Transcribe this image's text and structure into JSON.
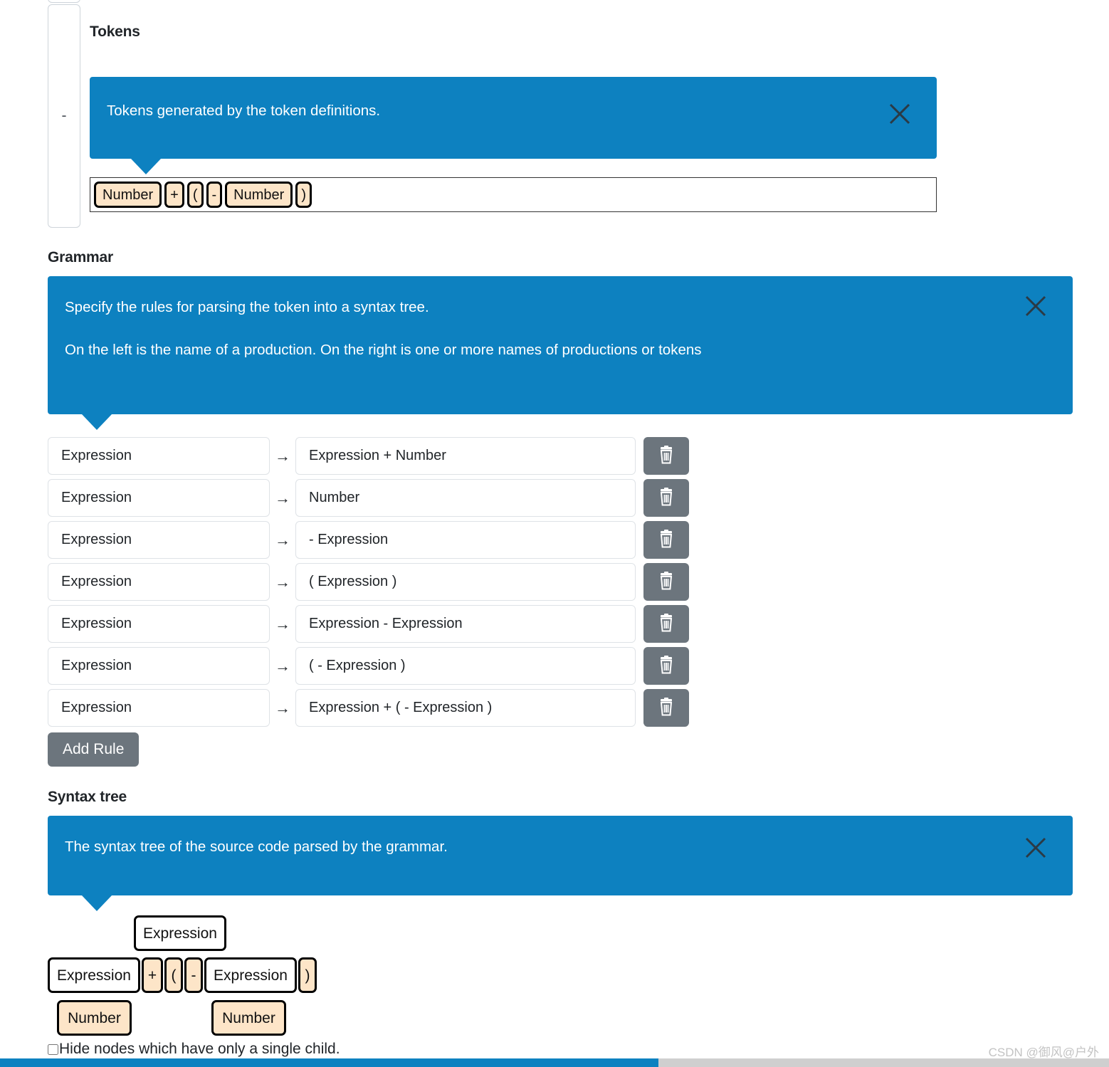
{
  "sections": {
    "tokens": {
      "heading": "Tokens",
      "tooltip": "Tokens generated by the token definitions.",
      "chips": [
        "Number",
        "+",
        "(",
        "-",
        "Number",
        ")"
      ]
    },
    "grammar": {
      "heading": "Grammar",
      "tooltip_line1": "Specify the rules for parsing the token into a syntax tree.",
      "tooltip_line2": "On the left is the name of a production. On the right is one or more names of productions or tokens",
      "arrow_glyph": "→",
      "rules": [
        {
          "lhs": "Expression",
          "rhs": "Expression + Number"
        },
        {
          "lhs": "Expression",
          "rhs": "Number"
        },
        {
          "lhs": "Expression",
          "rhs": "- Expression"
        },
        {
          "lhs": "Expression",
          "rhs": "( Expression )"
        },
        {
          "lhs": "Expression",
          "rhs": "Expression - Expression"
        },
        {
          "lhs": "Expression",
          "rhs": "( - Expression )"
        },
        {
          "lhs": "Expression",
          "rhs": "Expression + ( - Expression )"
        }
      ],
      "add_rule_label": "Add Rule"
    },
    "syntax_tree": {
      "heading": "Syntax tree",
      "tooltip": "The syntax tree of the source code parsed by the grammar.",
      "nodes": {
        "root": "Expression",
        "level2": [
          "Expression",
          "+",
          "(",
          "-",
          "Expression",
          ")"
        ],
        "level3": [
          "Number",
          "Number"
        ]
      },
      "hide_single_child_label": "Hide nodes which have only a single child.",
      "hide_single_child_checked": false
    }
  },
  "left_rail": {
    "value": "-"
  },
  "watermark": "CSDN @御风@户外",
  "colors": {
    "callout_blue": "#0d81c0",
    "token_chip": "#fde5c8",
    "delete_button": "#6c757d",
    "scrollbar_thumb": "#0d81c0"
  }
}
